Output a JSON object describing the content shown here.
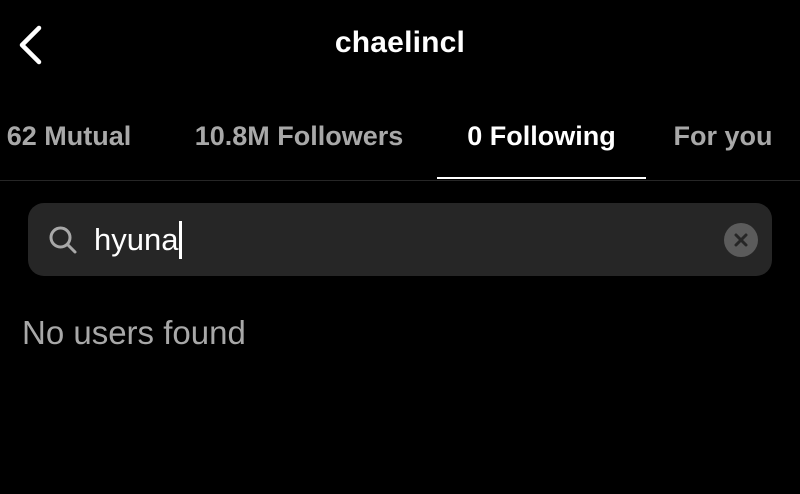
{
  "header": {
    "title": "chaelincl",
    "back_icon": "chevron-left-icon"
  },
  "tabs": [
    {
      "label": "62 Mutual",
      "active": false
    },
    {
      "label": "10.8M Followers",
      "active": false
    },
    {
      "label": "0 Following",
      "active": true
    },
    {
      "label": "For you",
      "active": false
    }
  ],
  "search": {
    "value": "hyuna",
    "icon": "search-icon",
    "clear_icon": "clear-icon"
  },
  "results": {
    "empty_message": "No users found"
  },
  "colors": {
    "background": "#000000",
    "search_background": "#262626",
    "active_text": "#ffffff",
    "inactive_text": "#a8a8a8"
  }
}
